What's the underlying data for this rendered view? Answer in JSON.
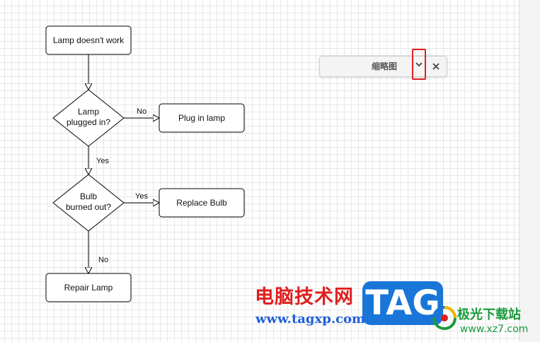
{
  "flowchart": {
    "nodes": {
      "start": "Lamp doesn't work",
      "decision1_line1": "Lamp",
      "decision1_line2": "plugged in?",
      "plug_in": "Plug in lamp",
      "decision2_line1": "Bulb",
      "decision2_line2": "burned out?",
      "replace": "Replace Bulb",
      "repair": "Repair Lamp"
    },
    "edges": {
      "d1_no": "No",
      "d1_yes": "Yes",
      "d2_yes": "Yes",
      "d2_no": "No"
    }
  },
  "minimap": {
    "title": "缩略图",
    "collapse_icon": "chevron-down-icon",
    "close_icon": "close-icon"
  },
  "watermark": {
    "site_name_cn": "电脑技术网",
    "site_url": "www.tagxp.com",
    "tag_text": "TAG",
    "site2_name_cn": "极光下载站",
    "site2_url": "www.xz7.com"
  },
  "colors": {
    "highlight": "#e02020",
    "watermark_red": "#e01e1e",
    "watermark_blue": "#1976d8",
    "watermark_green": "#1a9b3c"
  }
}
